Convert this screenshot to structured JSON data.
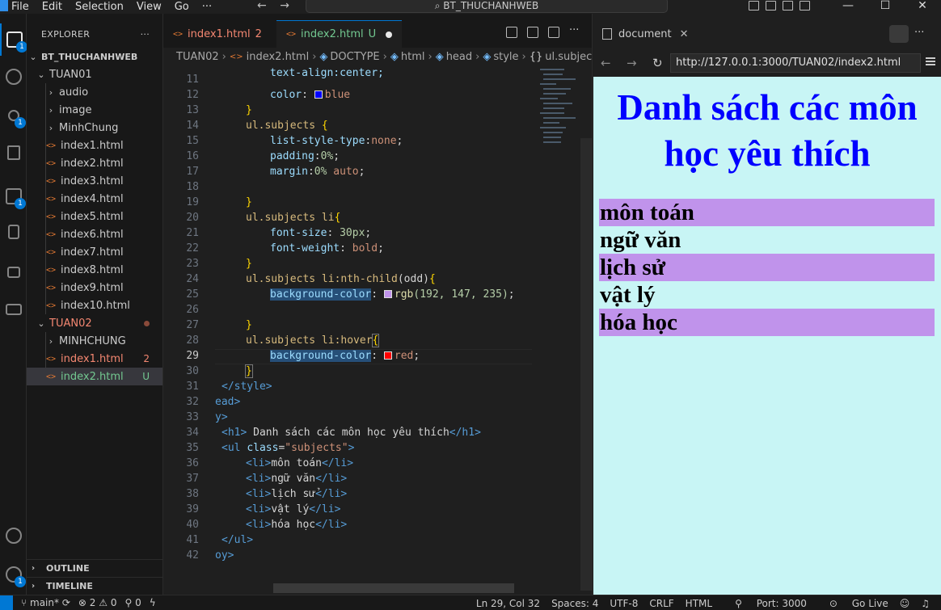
{
  "titlebar": {
    "menu": [
      "File",
      "Edit",
      "Selection",
      "View",
      "Go",
      "···"
    ],
    "back": "←",
    "forward": "→",
    "search_text": "BT_THUCHANHWEB",
    "window_controls": [
      "—",
      "☐",
      "✕"
    ]
  },
  "activity_badges": {
    "explorer": "1",
    "scm": "1",
    "extensions": "1",
    "settings": "1"
  },
  "sidebar": {
    "title": "EXPLORER",
    "more": "···",
    "root": "BT_THUCHANHWEB",
    "tuan01": "TUAN01",
    "tuan01_folders": [
      "audio",
      "image",
      "MinhChung"
    ],
    "tuan01_files": [
      "index1.html",
      "index2.html",
      "index3.html",
      "index4.html",
      "index5.html",
      "index6.html",
      "index7.html",
      "index8.html",
      "index9.html",
      "index10.html"
    ],
    "tuan02": "TUAN02",
    "tuan02_folder": "MINHCHUNG",
    "tuan02_file1": "index1.html",
    "tuan02_file1_status": "2",
    "tuan02_file2": "index2.html",
    "tuan02_file2_status": "U",
    "outline": "OUTLINE",
    "timeline": "TIMELINE",
    "file_icon": "<>"
  },
  "editor": {
    "tab1_name": "index1.html",
    "tab1_status": "2",
    "tab2_name": "index2.html",
    "tab2_status": "U",
    "breadcrumb": [
      "TUAN02",
      "index2.html",
      "DOCTYPE",
      "html",
      "head",
      "style",
      "ul.subjects"
    ],
    "line_numbers": [
      "11",
      "12",
      "13",
      "14",
      "15",
      "16",
      "17",
      "18",
      "19",
      "20",
      "21",
      "22",
      "23",
      "24",
      "25",
      "26",
      "27",
      "28",
      "29",
      "30",
      "31",
      "32",
      "33",
      "34",
      "35",
      "36",
      "37",
      "38",
      "39",
      "40",
      "41",
      "42"
    ],
    "current_line": "29",
    "code": {
      "l11": "text-align:center;",
      "l12_prop": "color",
      "l12_val": "blue",
      "l13": "}",
      "l14_sel": "ul.subjects",
      "l14_rest": " {",
      "l15_prop": "list-style-type",
      "l15_val": "none",
      "l16_prop": "padding",
      "l16_val": "0%",
      "l17_prop": "margin",
      "l17_val1": "0%",
      "l17_val2": " auto",
      "l19": "}",
      "l20_sel": "ul.subjects li",
      "l20_rest": "{",
      "l21_prop": "font-size",
      "l21_val": "30px",
      "l22_prop": "font-weight",
      "l22_val": "bold",
      "l23": "}",
      "l24_sel": "ul.subjects li:nth-child",
      "l24_arg": "(odd)",
      "l24_rest": "{",
      "l25_prop": "background-color",
      "l25_fn": "rgb",
      "l25_args": "(192, 147, 235)",
      "l27": "}",
      "l28_sel": "ul.subjects li:hover",
      "l28_rest": "{",
      "l29_prop": "background-color",
      "l29_val": "red",
      "l30": "}",
      "l31": "</style>",
      "l32": "ead>",
      "l33": "y>",
      "l34_open": "<h1>",
      "l34_text": " Danh sách các môn học yêu thích",
      "l34_close": "</h1>",
      "l35_open": "<ul ",
      "l35_attr": "class",
      "l35_val": "\"subjects\"",
      "l35_close": ">",
      "li_open": "<li>",
      "li_close": "</li>",
      "items": [
        "môn toán",
        "ngữ văn",
        "lịch sử",
        "vật lý",
        "hóa học"
      ],
      "l41": "</ul>",
      "l42": "oy>"
    }
  },
  "browser": {
    "tab_title": "document",
    "url": "http://127.0.0.1:3000/TUAN02/index2.html",
    "more": "···",
    "page": {
      "heading": "Danh sách các môn học yêu thích",
      "items": [
        "môn toán",
        "ngữ văn",
        "lịch sử",
        "vật lý",
        "hóa học"
      ]
    }
  },
  "status": {
    "branch": "main*",
    "errors": "2",
    "warnings": "0",
    "ports": "0",
    "cursor": "Ln 29, Col 32",
    "spaces": "Spaces: 4",
    "encoding": "UTF-8",
    "eol": "CRLF",
    "language": "HTML",
    "port": "Port: 3000",
    "golive": "Go Live"
  },
  "colors": {
    "accent": "#0078d4",
    "page_bg": "#c8f5f5",
    "heading_color": "#0000ff",
    "odd_row_bg": "#c093eb",
    "hover_color": "red"
  }
}
